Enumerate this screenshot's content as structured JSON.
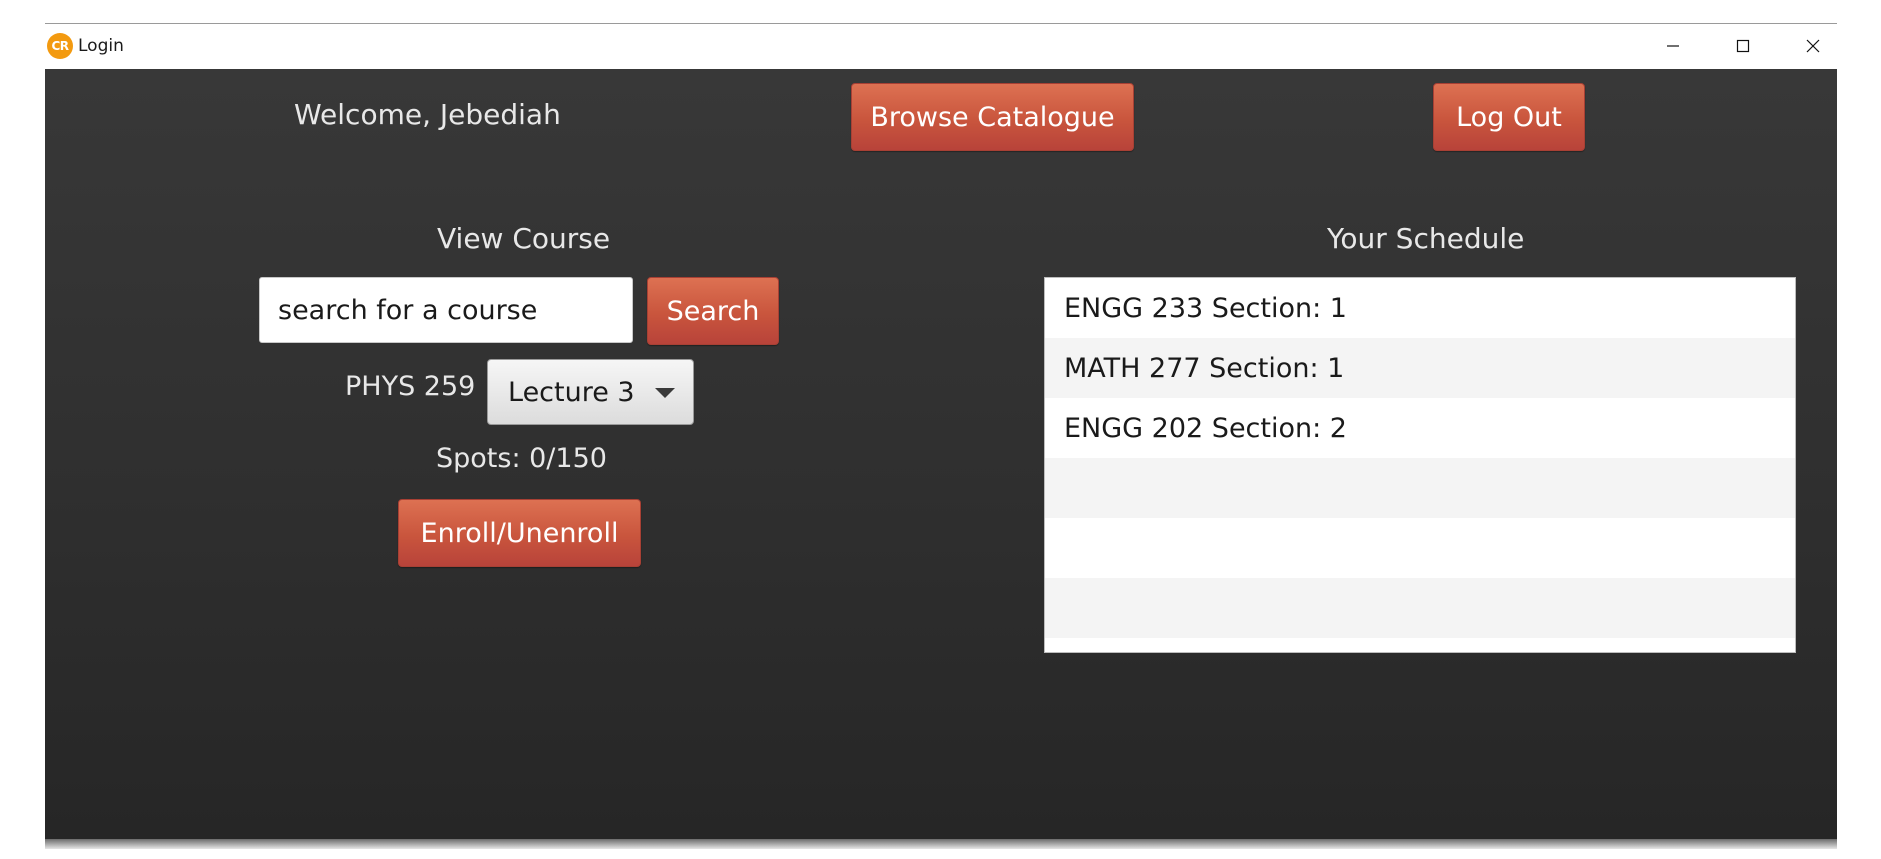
{
  "window": {
    "title": "Login",
    "icon_text": "CR",
    "icon_color": "#f39a10"
  },
  "header": {
    "welcome": "Welcome, Jebediah",
    "browse_label": "Browse Catalogue",
    "logout_label": "Log Out"
  },
  "view_course": {
    "heading": "View Course",
    "search_value": "search for a course",
    "search_button": "Search",
    "course_code": "PHYS 259",
    "section_selected": "Lecture 3",
    "spots": "Spots: 0/150",
    "enroll_button": "Enroll/Unenroll"
  },
  "schedule": {
    "heading": "Your Schedule",
    "items": [
      "ENGG 233 Section: 1",
      "MATH 277 Section: 1",
      "ENGG 202 Section: 2",
      "",
      "",
      ""
    ]
  },
  "colors": {
    "accent_button": "#c9553d",
    "background": "#333333",
    "text_light": "#e8e8e8"
  }
}
